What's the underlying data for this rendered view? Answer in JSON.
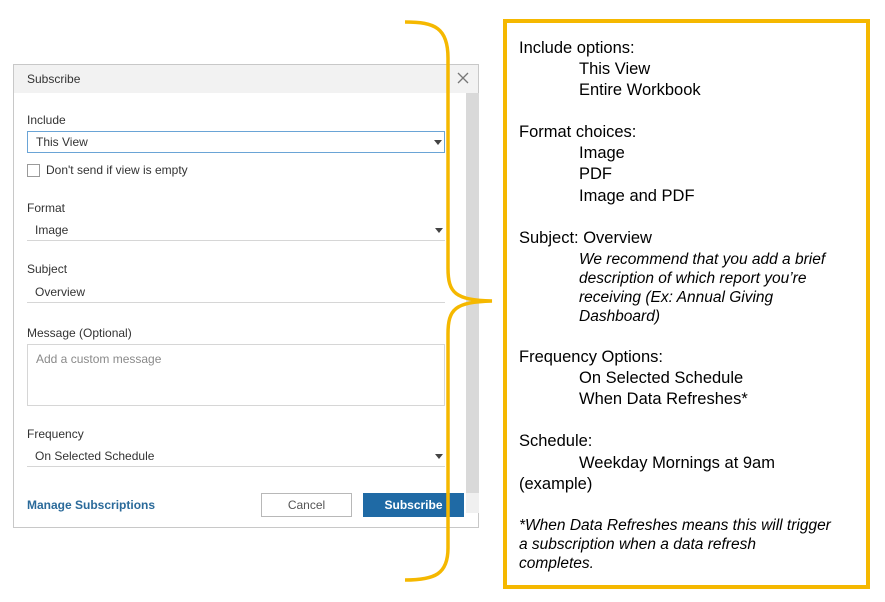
{
  "dialog": {
    "title": "Subscribe",
    "include_label": "Include",
    "include_value": "This View",
    "dont_send_label": "Don't send if view is empty",
    "format_label": "Format",
    "format_value": "Image",
    "subject_label": "Subject",
    "subject_value": "Overview",
    "message_label": "Message (Optional)",
    "message_placeholder": "Add a custom message",
    "frequency_label": "Frequency",
    "frequency_value": "On Selected Schedule",
    "manage_link": "Manage Subscriptions",
    "cancel_label": "Cancel",
    "subscribe_label": "Subscribe"
  },
  "notes": {
    "include_heading": "Include options:",
    "include_opt1": "This View",
    "include_opt2": "Entire Workbook",
    "format_heading": "Format choices:",
    "format_opt1": "Image",
    "format_opt2": "PDF",
    "format_opt3": "Image and PDF",
    "subject_heading": "Subject:  Overview",
    "subject_note_line1": "We recommend that you add a brief",
    "subject_note_line2": "description of which report you’re",
    "subject_note_line3": "receiving (Ex: Annual Giving",
    "subject_note_line4": "Dashboard)",
    "frequency_heading": "Frequency Options:",
    "frequency_opt1": "On Selected Schedule",
    "frequency_opt2": "When Data Refreshes*",
    "schedule_heading": "Schedule:",
    "schedule_line1": "Weekday Mornings at 9am",
    "schedule_line2": "(example)",
    "footnote_line1": "*When Data Refreshes means this will trigger",
    "footnote_line2": "a subscription when a data refresh",
    "footnote_line3": "completes."
  },
  "colors": {
    "accent_yellow": "#f5b800",
    "primary_button": "#1f6aa5",
    "link": "#2a6a9a"
  }
}
